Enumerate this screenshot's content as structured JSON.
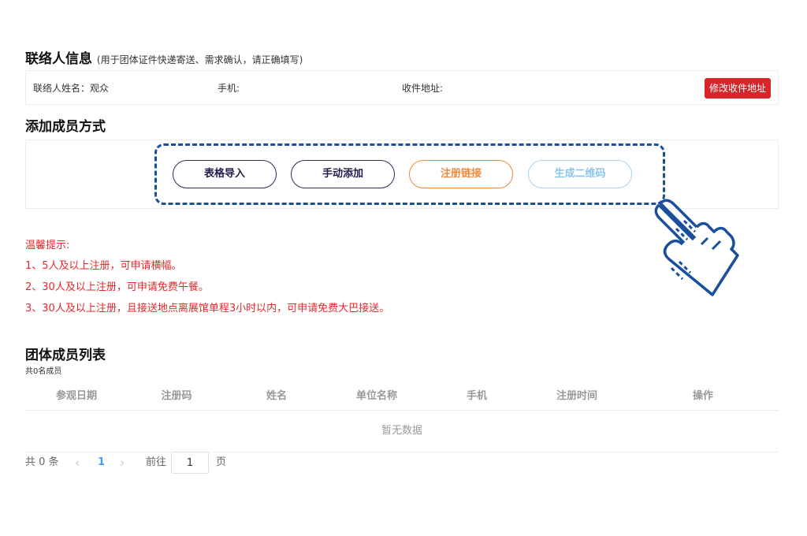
{
  "contact": {
    "title": "联络人信息",
    "note": "(用于团体证件快递寄送、需求确认，请正确填写)",
    "name_field": "联络人姓名：观众",
    "phone_field": "手机:",
    "address_field": "收件地址:",
    "edit_button": "修改收件地址"
  },
  "methods": {
    "title": "添加成员方式",
    "buttons": [
      "表格导入",
      "手动添加",
      "注册链接",
      "生成二维码"
    ]
  },
  "tips": {
    "heading": "温馨提示:",
    "items": [
      "1、5人及以上注册，可申请横幅。",
      "2、30人及以上注册，可申请免费午餐。",
      "3、30人及以上注册，且接送地点离展馆单程3小时以内，可申请免费大巴接送。"
    ]
  },
  "members": {
    "title": "团体成员列表",
    "count_text": "共0名成员",
    "columns": [
      "参观日期",
      "注册码",
      "姓名",
      "单位名称",
      "手机",
      "注册时间",
      "操作"
    ],
    "empty_text": "暂无数据"
  },
  "pagination": {
    "total_text": "共 0 条",
    "prev": "‹",
    "current_page": "1",
    "next": "›",
    "goto_label": "前往",
    "goto_value": "1",
    "page_suffix": "页"
  },
  "colors": {
    "danger": "#d9252a",
    "tip_red": "#e8262c",
    "dash_blue": "#1a4f9c",
    "page_active": "#409eff"
  },
  "icons": {
    "pointer": "hand-pointer-icon"
  }
}
